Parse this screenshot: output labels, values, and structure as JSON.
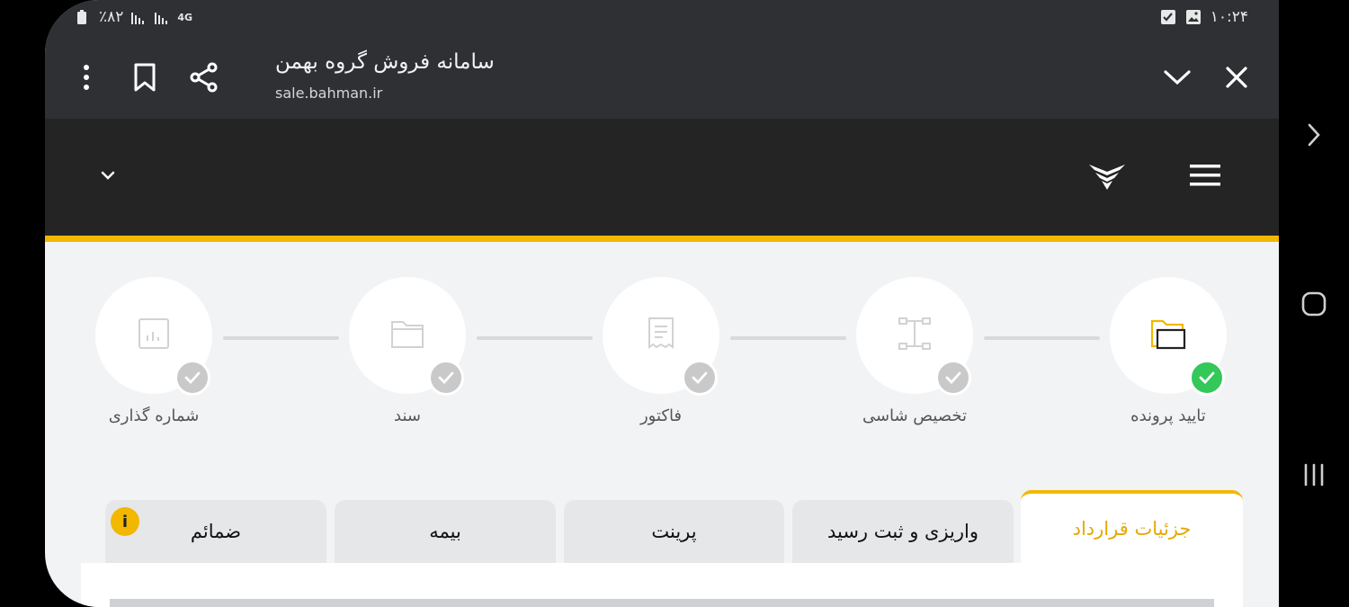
{
  "status_bar": {
    "battery": "٪۸۲",
    "network": "4G",
    "time": "۱۰:۲۴"
  },
  "browser": {
    "title": "سامانه فروش گروه بهمن",
    "url": "sale.bahman.ir",
    "icons": [
      "more-vert-icon",
      "bookmark-icon",
      "share-icon",
      "chevron-down-icon",
      "close-icon"
    ]
  },
  "topnav": {
    "icons": [
      "chevron-down-icon",
      "bahman-logo-icon",
      "hamburger-menu-icon"
    ]
  },
  "steps": [
    {
      "label": "تایید پرونده",
      "status": "done",
      "icon": "folder-icon"
    },
    {
      "label": "تخصیص شاسی",
      "status": "pending",
      "icon": "chassis-icon"
    },
    {
      "label": "فاکتور",
      "status": "pending",
      "icon": "receipt-icon"
    },
    {
      "label": "سند",
      "status": "pending",
      "icon": "folder-icon"
    },
    {
      "label": "شماره گذاری",
      "status": "pending",
      "icon": "chart-icon"
    }
  ],
  "tabs": [
    {
      "label": "جزئیات قرارداد",
      "active": true
    },
    {
      "label": "واریزی و ثبت رسید",
      "active": false
    },
    {
      "label": "پرینت",
      "active": false
    },
    {
      "label": "بیمه",
      "active": false
    },
    {
      "label": "ضمائم",
      "active": false,
      "badge": "i"
    }
  ],
  "colors": {
    "accent": "#f2b800",
    "done": "#34c759",
    "dark": "#242424",
    "chrome": "#2f3033"
  }
}
